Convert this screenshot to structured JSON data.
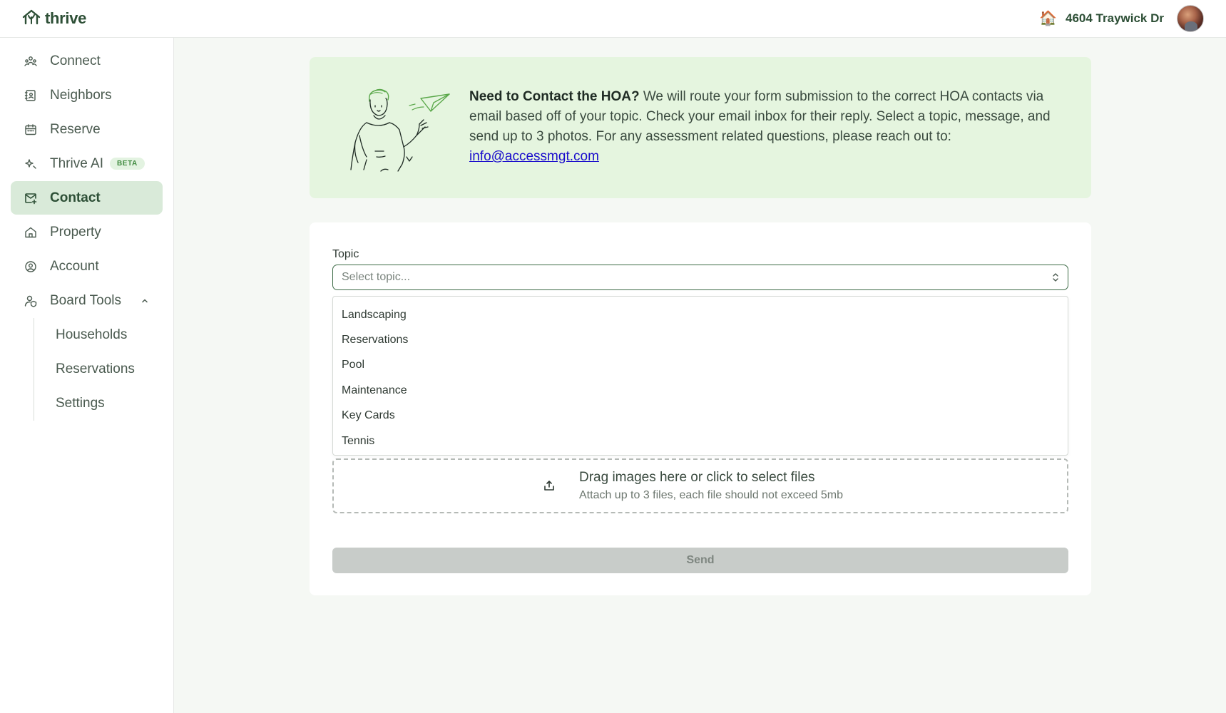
{
  "app": {
    "logo_text": "thrive"
  },
  "header": {
    "address": "4604 Traywick Dr",
    "house_icon": "🏠"
  },
  "sidebar": {
    "items": [
      {
        "label": "Connect",
        "icon": "people-icon"
      },
      {
        "label": "Neighbors",
        "icon": "address-book-icon"
      },
      {
        "label": "Reserve",
        "icon": "calendar-icon"
      },
      {
        "label": "Thrive AI",
        "icon": "sparkle-icon",
        "badge": "BETA"
      },
      {
        "label": "Contact",
        "icon": "mail-plus-icon",
        "active": true
      },
      {
        "label": "Property",
        "icon": "home-icon"
      },
      {
        "label": "Account",
        "icon": "user-circle-icon"
      },
      {
        "label": "Board Tools",
        "icon": "user-shield-icon",
        "expanded": true
      }
    ],
    "board_tools": [
      {
        "label": "Households"
      },
      {
        "label": "Reservations"
      },
      {
        "label": "Settings"
      }
    ]
  },
  "banner": {
    "heading": "Need to Contact the HOA?",
    "body": " We will route your form submission to the correct HOA contacts via email based off of your topic. Check your email inbox for their reply. Select a topic, message, and send up to 3 photos. For any assessment related questions, please reach out to:",
    "email": "info@accessmgt.com"
  },
  "form": {
    "topic_label": "Topic",
    "topic_placeholder": "Select topic...",
    "topic_options": [
      "Landscaping",
      "Reservations",
      "Pool",
      "Maintenance",
      "Key Cards",
      "Tennis"
    ],
    "upload_title": "Drag images here or click to select files",
    "upload_hint": "Attach up to 3 files, each file should not exceed 5mb",
    "send_label": "Send"
  },
  "colors": {
    "brand": "#2d4f36",
    "active_nav": "#d9ead9",
    "banner_bg": "#e5f5df",
    "page_bg": "#f5f8f4",
    "disabled_button": "#c8ccc9"
  }
}
